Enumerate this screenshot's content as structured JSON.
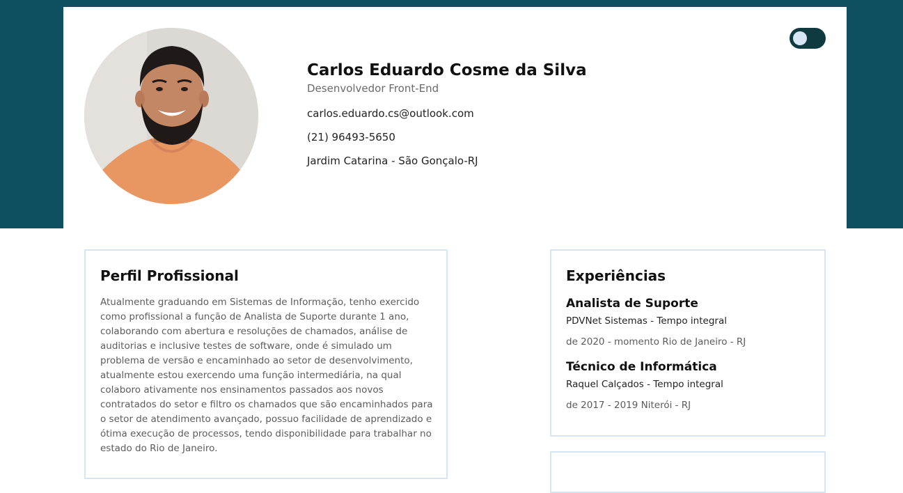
{
  "header": {
    "name": "Carlos Eduardo Cosme da Silva",
    "role": "Desenvolvedor Front-End",
    "email": "carlos.eduardo.cs@outlook.com",
    "phone": "(21) 96493-5650",
    "address": "Jardim Catarina - São Gonçalo-RJ",
    "avatar_icon": "profile-photo",
    "theme_toggle_icon": "theme-toggle-switch"
  },
  "profile": {
    "title": "Perfil Profissional",
    "text": "Atualmente graduando em Sistemas de Informação, tenho exercido como profissional a função de Analista de Suporte durante 1 ano, colaborando com abertura e resoluções de chamados, análise de auditorias e inclusive testes de software, onde é simulado um problema de versão e encaminhado ao setor de desenvolvimento, atualmente estou exercendo uma função intermediária, na qual colaboro ativamente nos ensinamentos passados aos novos contratados do setor e filtro os chamados que são encaminhados para o setor de atendimento avançado, possuo facilidade de aprendizado e ótima execução de processos, tendo disponibilidade para trabalhar no estado do Rio de Janeiro."
  },
  "experience": {
    "title": "Experiências",
    "items": [
      {
        "title": "Analista de Suporte",
        "company": "PDVNet Sistemas - Tempo integral",
        "period": "de 2020 - momento Rio de Janeiro - RJ"
      },
      {
        "title": "Técnico de Informática",
        "company": "Raquel Calçados - Tempo integral",
        "period": "de 2017 - 2019 Niterói - RJ"
      }
    ]
  },
  "colors": {
    "band": "#0f5060",
    "toggle_track": "#0f3a40",
    "toggle_knob": "#d6e6f4",
    "card_border": "#d4e5f4"
  }
}
